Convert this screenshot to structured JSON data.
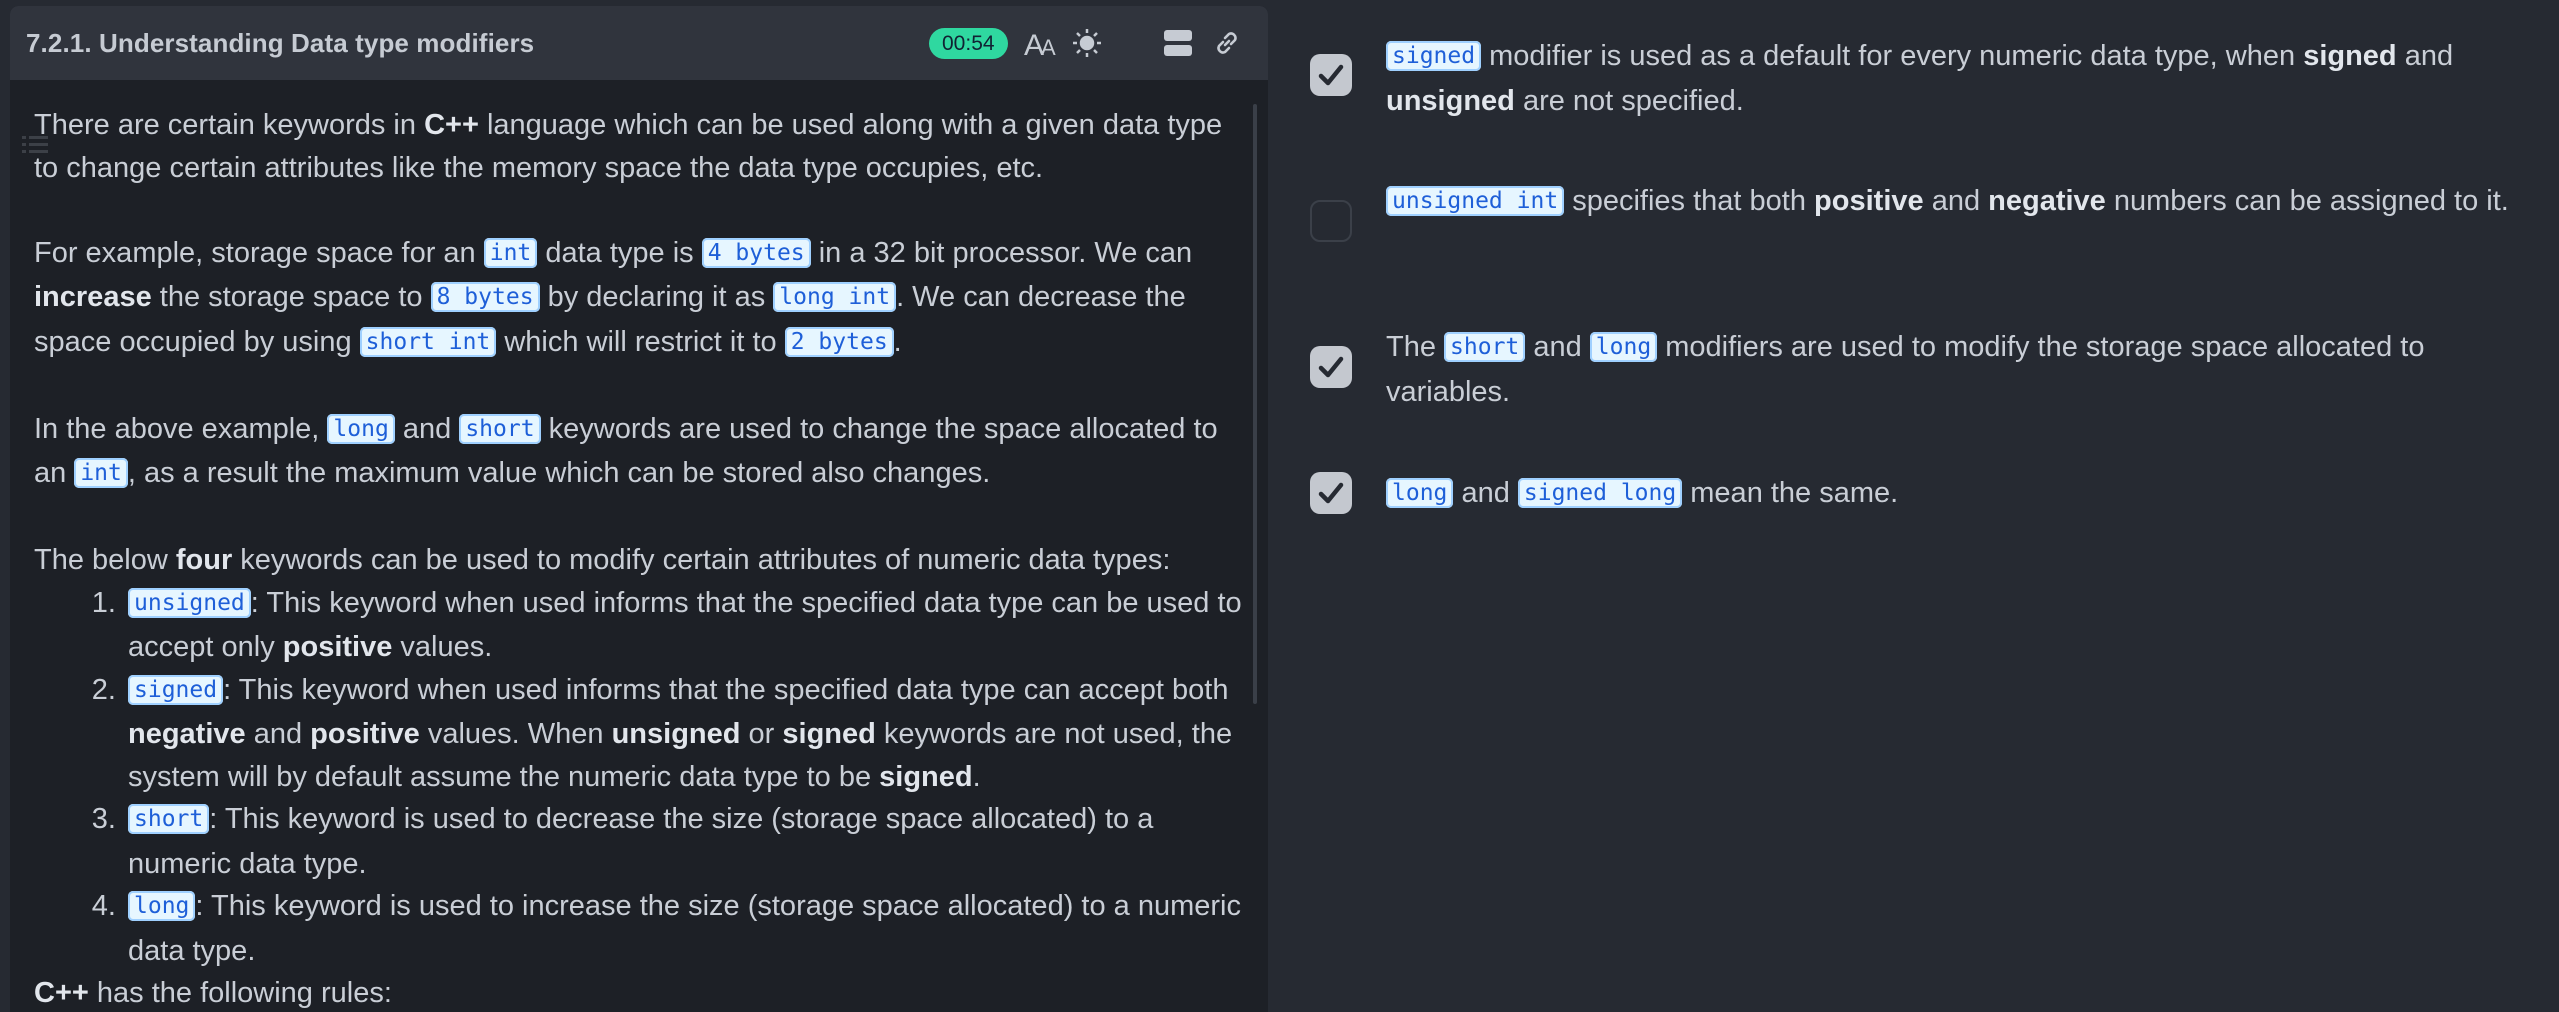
{
  "header": {
    "title": "7.2.1. Understanding Data type modifiers",
    "timer": "00:54",
    "icons": [
      "font-size-icon",
      "theme-sun-icon",
      "layout-icon",
      "link-icon"
    ]
  },
  "content": {
    "p1": {
      "t1": "There are certain keywords in ",
      "b1": "C++",
      "t2": " language which can be used along with a given data type to change certain attributes like the memory space the data type occupies, etc."
    },
    "p2": {
      "t1": "For example, storage space for an ",
      "c1": "int",
      "t2": " data type is ",
      "c2": "4 bytes",
      "t3": " in a 32 bit processor. We can ",
      "b1": "increase",
      "t4": " the storage space to ",
      "c3": "8 bytes",
      "t5": " by declaring it as ",
      "c4": "long int",
      "t6": ". We can decrease the space occupied by using ",
      "c5": "short int",
      "t7": " which will restrict it to ",
      "c6": "2 bytes",
      "t8": "."
    },
    "p3": {
      "t1": "In the above example, ",
      "c1": "long",
      "t2": " and ",
      "c2": "short",
      "t3": " keywords are used to change the space allocated to an ",
      "c3": "int",
      "t4": ", as a result the maximum value which can be stored also changes."
    },
    "p4": {
      "t1": "The below ",
      "b1": "four",
      "t2": " keywords can be used to modify certain attributes of numeric data types:"
    },
    "list": {
      "i1": {
        "c": "unsigned",
        "t1": ": This keyword when used informs that the specified data type can be used to accept only ",
        "b1": "positive",
        "t2": " values."
      },
      "i2": {
        "c": "signed",
        "t1": ": This keyword when used informs that the specified data type can accept both ",
        "b1": "negative",
        "t2": " and ",
        "b2": "positive",
        "t3": " values. When ",
        "b3": "unsigned",
        "t4": " or ",
        "b4": "signed",
        "t5": " keywords are not used, the system will by default assume the numeric data type to be ",
        "b5": "signed",
        "t6": "."
      },
      "i3": {
        "c": "short",
        "t1": ": This keyword is used to decrease the size (storage space allocated) to a numeric data type."
      },
      "i4": {
        "c": "long",
        "t1": ": This keyword is used to increase the size (storage space allocated) to a numeric data type."
      }
    },
    "p5": {
      "b1": "C++",
      "t1": " has the following rules:"
    }
  },
  "options": [
    {
      "checked": true,
      "c1": "signed",
      "t1": " modifier is used as a default for every numeric data type, when ",
      "b1": "signed",
      "t2": " and ",
      "b2": "unsigned",
      "t3": " are not specified."
    },
    {
      "checked": false,
      "c1": "unsigned int",
      "t1": " specifies that both ",
      "b1": "positive",
      "t2": " and ",
      "b2": "negative",
      "t3": " numbers can be assigned to it."
    },
    {
      "checked": true,
      "t0": "The ",
      "c1": "short",
      "t1": " and ",
      "c2": "long",
      "t2": " modifiers are used to modify the storage space allocated to variables."
    },
    {
      "checked": true,
      "c1": "long",
      "t1": " and ",
      "c2": "signed long",
      "t2": " mean the same."
    }
  ],
  "colors": {
    "timer_bg": "#2fd8a0",
    "code_bg": "#e6f6ff",
    "code_text": "#1e5fd8",
    "checkbox_checked": "#c4c8cf"
  }
}
